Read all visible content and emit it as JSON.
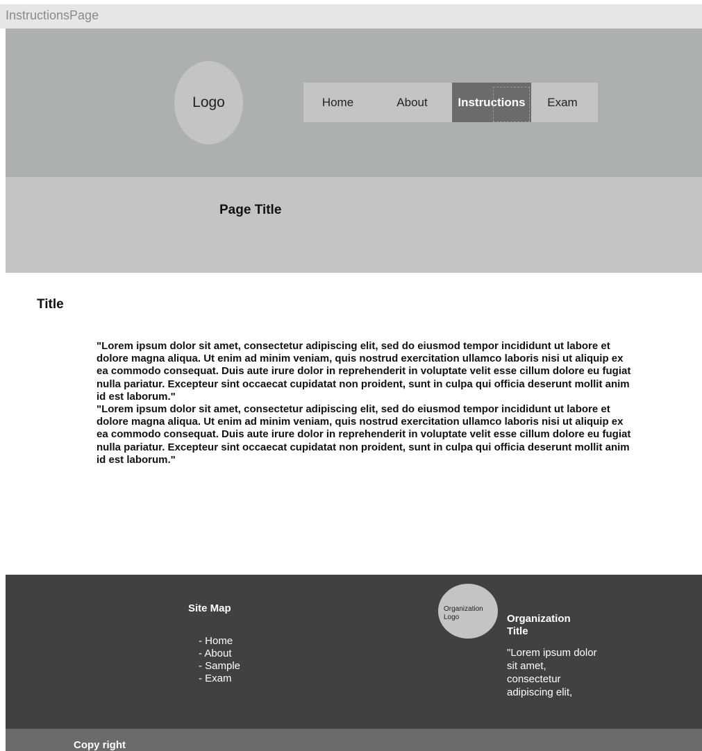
{
  "window": {
    "title": "InstructionsPage"
  },
  "header": {
    "logo_label": "Logo",
    "nav": {
      "home": "Home",
      "about": "About",
      "instructions": "Instructions",
      "exam": "Exam"
    },
    "active_nav": "instructions"
  },
  "banner": {
    "page_title": "Page Title"
  },
  "content": {
    "title": "Title",
    "paragraphs": [
      "\"Lorem ipsum dolor sit amet, consectetur adipiscing elit, sed do eiusmod tempor incididunt ut labore et dolore magna aliqua. Ut enim ad minim veniam, quis nostrud exercitation ullamco laboris nisi ut aliquip ex ea commodo consequat. Duis aute irure dolor in reprehenderit in voluptate velit esse cillum dolore eu fugiat nulla pariatur. Excepteur sint occaecat cupidatat non proident, sunt in culpa qui officia deserunt mollit anim id est laborum.\"",
      "\"Lorem ipsum dolor sit amet, consectetur adipiscing elit, sed do eiusmod tempor incididunt ut labore et dolore magna aliqua. Ut enim ad minim veniam, quis nostrud exercitation ullamco laboris nisi ut aliquip ex ea commodo consequat. Duis aute irure dolor in reprehenderit in voluptate velit esse cillum dolore eu fugiat nulla pariatur. Excepteur sint occaecat cupidatat non proident, sunt in culpa qui officia deserunt mollit anim id est laborum.\""
    ]
  },
  "footer": {
    "sitemap": {
      "title": "Site Map",
      "items": [
        "- Home",
        "- About",
        "- Sample",
        "- Exam"
      ]
    },
    "organization": {
      "logo_label": "Organization Logo",
      "title": "Organization Title",
      "text": "\"Lorem ipsum dolor sit amet, consectetur adipiscing elit,"
    },
    "copyright": "Copy right"
  }
}
